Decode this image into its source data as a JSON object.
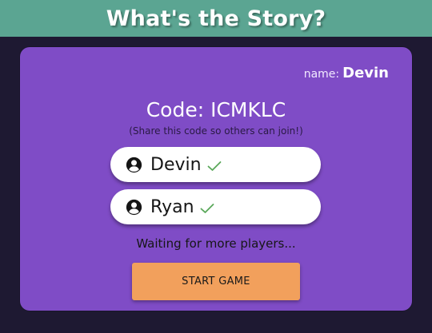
{
  "header": {
    "title": "What's the Story?"
  },
  "card": {
    "name_label": "name:",
    "name_value": "Devin",
    "code_text": "Code: ICMKLC",
    "share_note": "(Share this code so others can join!)",
    "players": [
      {
        "name": "Devin",
        "icon": "user-circle-icon",
        "status_icon": "checkmark-icon",
        "ready": true
      },
      {
        "name": "Ryan",
        "icon": "user-circle-icon",
        "status_icon": "checkmark-icon",
        "ready": true
      }
    ],
    "waiting_text": "Waiting for more players...",
    "start_button": "START GAME"
  },
  "colors": {
    "background": "#1e1932",
    "header": "#5ba592",
    "card": "#7f4cc6",
    "button": "#f2a05c",
    "check": "#5aa85a"
  }
}
